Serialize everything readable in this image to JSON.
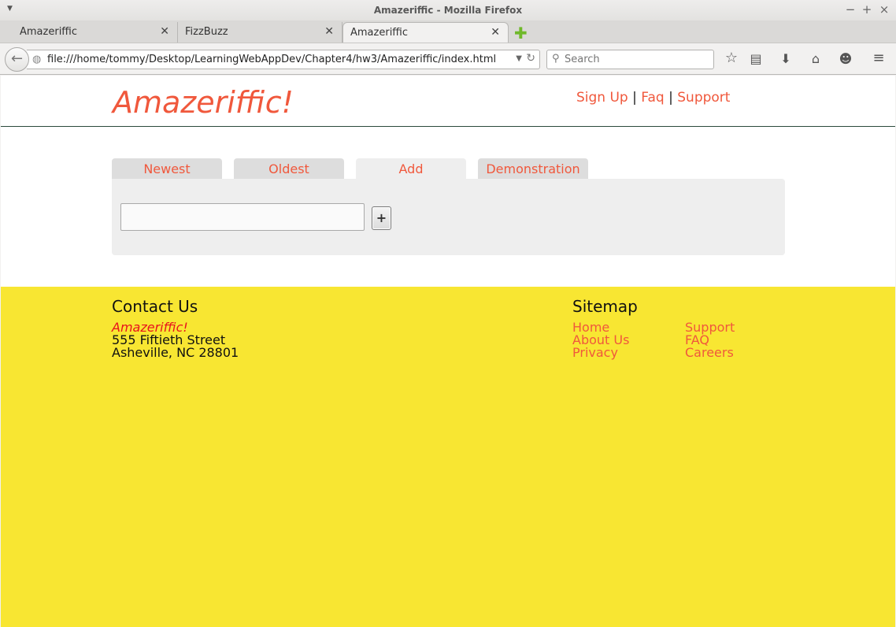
{
  "window": {
    "title": "Amazeriffic - Mozilla Firefox",
    "controls": {
      "minimize": "−",
      "maximize": "+",
      "close": "×"
    }
  },
  "tabs": [
    {
      "label": "Amazeriffic",
      "active": false
    },
    {
      "label": "FizzBuzz",
      "active": false
    },
    {
      "label": "Amazeriffic",
      "active": true
    }
  ],
  "navbar": {
    "url": "file:///home/tommy/Desktop/LearningWebAppDev/Chapter4/hw3/Amazeriffic/index.html",
    "search_placeholder": "Search",
    "icons": [
      "back-icon",
      "bookmark-star-icon",
      "reading-list-icon",
      "download-icon",
      "home-icon",
      "chat-icon",
      "hamburger-menu-icon"
    ]
  },
  "header": {
    "logo": "Amazeriffic!",
    "nav": {
      "signup": "Sign Up",
      "faq": "Faq",
      "support": "Support",
      "separator": "|"
    }
  },
  "main": {
    "tabs": [
      {
        "label": "Newest",
        "active": false
      },
      {
        "label": "Oldest",
        "active": false
      },
      {
        "label": "Add",
        "active": true
      },
      {
        "label": "Demonstration",
        "active": false
      }
    ],
    "add_input_value": "",
    "add_button_label": "+"
  },
  "footer": {
    "contact": {
      "heading": "Contact Us",
      "brand": "Amazeriffic!",
      "street": "555 Fiftieth Street",
      "city": "Asheville, NC 28801"
    },
    "sitemap": {
      "heading": "Sitemap",
      "col1": [
        "Home",
        "About Us",
        "Privacy"
      ],
      "col2": [
        "Support",
        "FAQ",
        "Careers"
      ]
    }
  },
  "colors": {
    "accent": "#f0583c",
    "footer_bg": "#f8e632",
    "brand_red": "#e8131d",
    "tab_bg": "#dddddd",
    "panel_bg": "#eeeeee"
  }
}
